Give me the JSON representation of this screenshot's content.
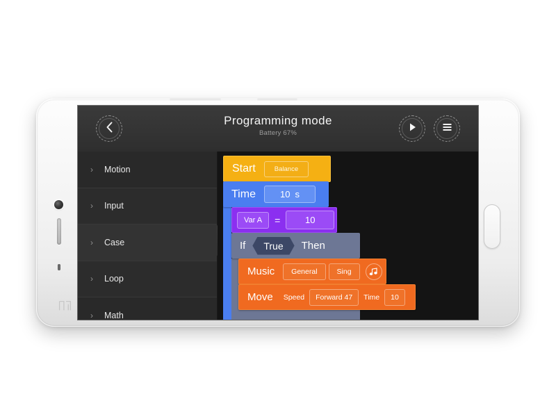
{
  "header": {
    "title": "Programming mode",
    "battery": "Battery 67%",
    "back_icon": "chevron-left-icon",
    "play_icon": "play-icon",
    "menu_icon": "hamburger-menu-icon"
  },
  "sidebar": {
    "collapse_icon": "chevron-left-icon",
    "items": [
      {
        "label": "Motion",
        "chevron": "›",
        "selected": false
      },
      {
        "label": "Input",
        "chevron": "›",
        "selected": false
      },
      {
        "label": "Case",
        "chevron": "›",
        "selected": true
      },
      {
        "label": "Loop",
        "chevron": "›",
        "selected": false
      },
      {
        "label": "Math",
        "chevron": "›",
        "selected": false
      }
    ]
  },
  "canvas": {
    "start_block": {
      "label": "Start",
      "mode": "Balance",
      "color": "#f5b013"
    },
    "time_block": {
      "label": "Time",
      "value": "10",
      "unit": "s",
      "color": "#4a7ef0"
    },
    "var_block": {
      "name": "Var A",
      "operator": "=",
      "value": "10",
      "color": "#8b2ff0"
    },
    "if_block": {
      "if_label": "If",
      "condition": "True",
      "then_label": "Then",
      "color": "#6d7795"
    },
    "music_block": {
      "label": "Music",
      "category": "General",
      "action": "Sing",
      "icon": "music-note-icon",
      "color": "#f06a20"
    },
    "move_block": {
      "label": "Move",
      "speed_label": "Speed",
      "speed_value": "Forward 47",
      "time_label": "Time",
      "time_value": "10",
      "color": "#f06a20"
    }
  }
}
